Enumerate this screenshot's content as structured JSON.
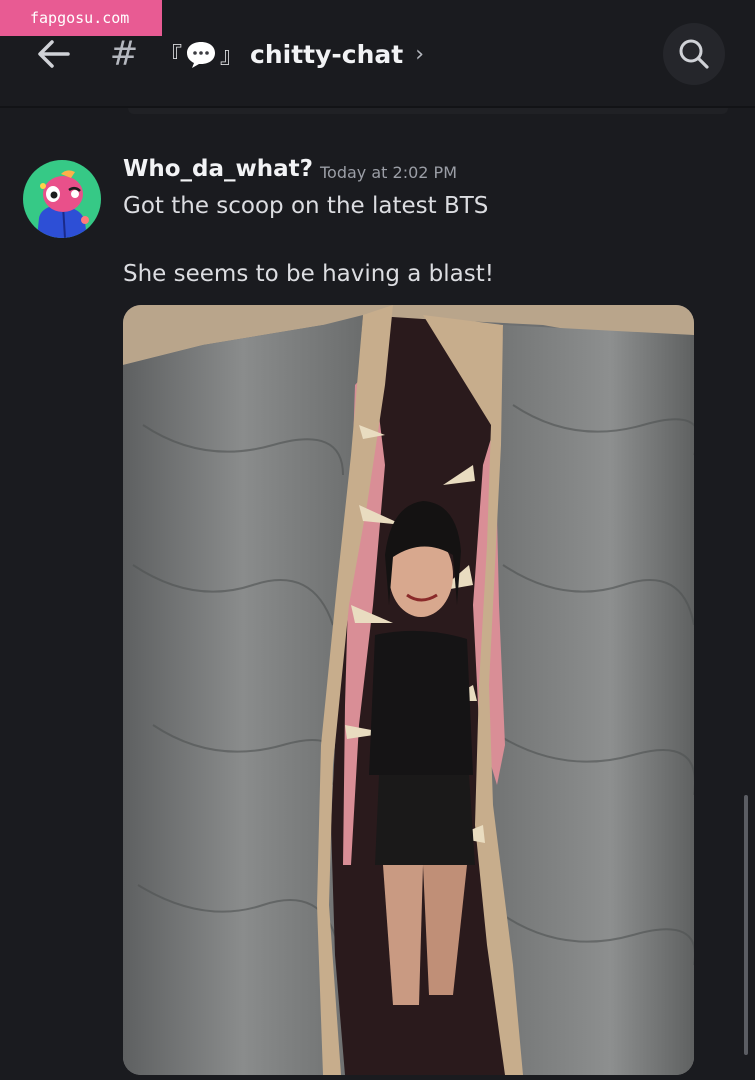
{
  "watermark": {
    "text": "fapgosu.com"
  },
  "header": {
    "back_icon": "arrow-left-icon",
    "channel_type_icon": "hash",
    "channel_prefix_bracket": "『",
    "channel_emoji": "speech-bubble-icon",
    "channel_suffix_bracket": "』",
    "channel_name": "chitty-chat",
    "chevron": "›",
    "hash_glyph": "#",
    "search_icon": "search-icon"
  },
  "message": {
    "author": "Who_da_what?",
    "timestamp": "Today at 2:02 PM",
    "lines": [
      "Got the scoop on the latest BTS",
      "She seems to be having a blast!"
    ],
    "avatar_icon": "avatar-character-icon",
    "attachment_icon": "photo-attachment"
  },
  "colors": {
    "background": "#1a1b1f",
    "watermark": "#e85b93",
    "avatar_bg": "#36c986"
  }
}
